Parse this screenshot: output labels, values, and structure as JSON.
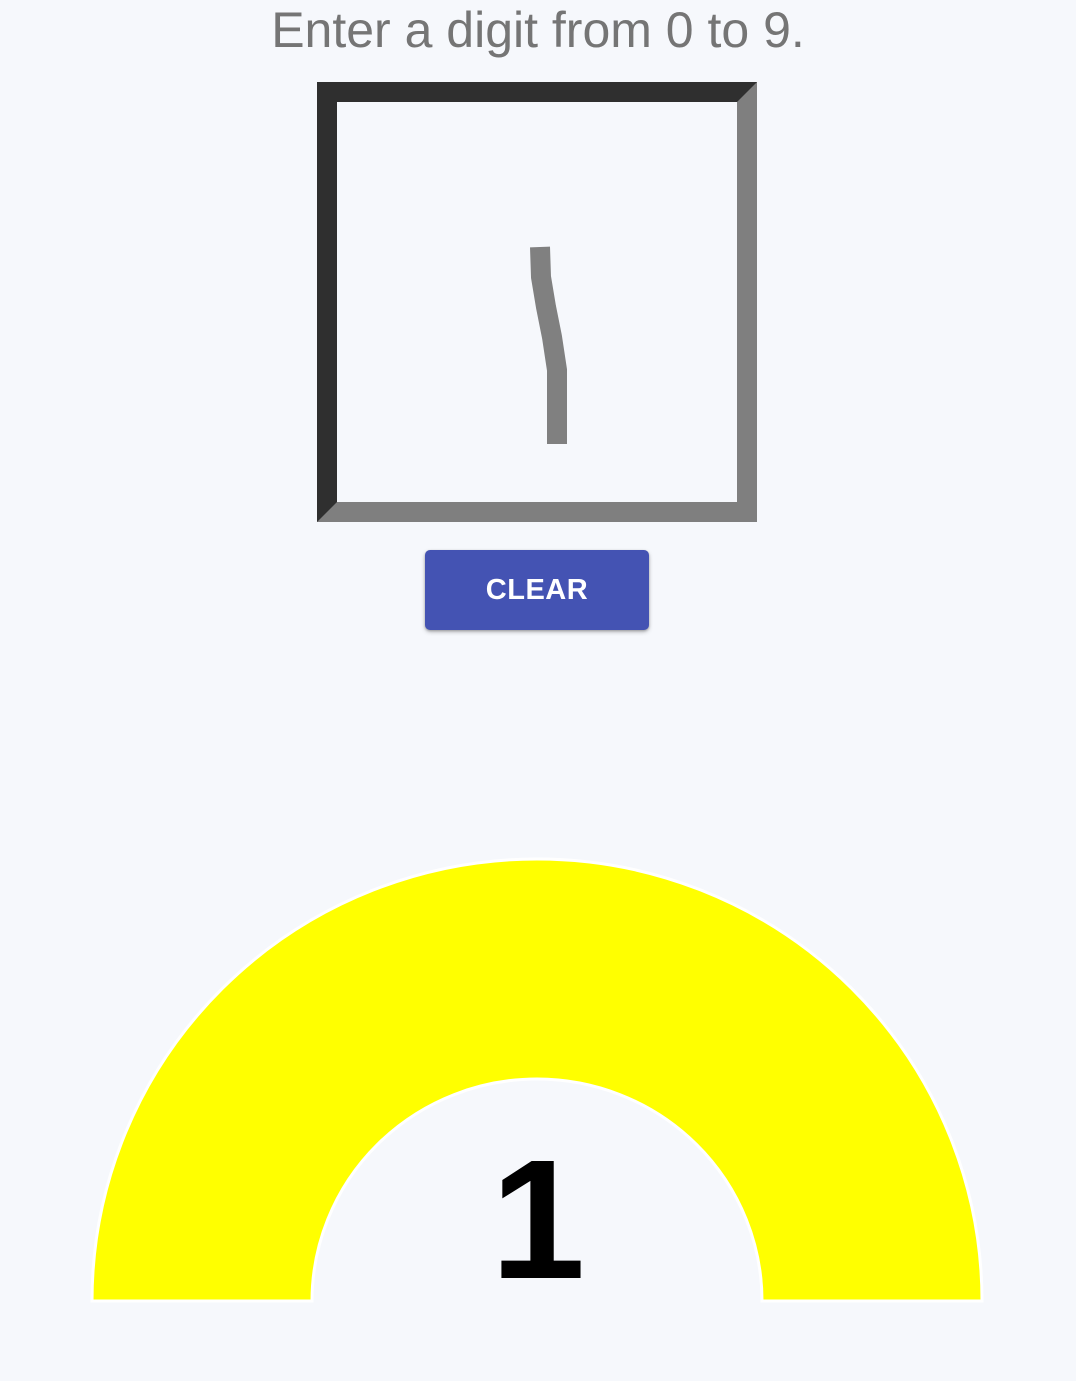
{
  "instruction": {
    "text": "Enter a digit from 0 to 9."
  },
  "drawing_canvas": {
    "stroke_color": "#808080",
    "frame_color_dark": "#2f2f2f",
    "frame_color_light": "#7f7f7f"
  },
  "clear_button": {
    "label": "CLEAR",
    "color": "#4453b3"
  },
  "prediction": {
    "digit": "1",
    "gauge_color": "#ffff00"
  }
}
